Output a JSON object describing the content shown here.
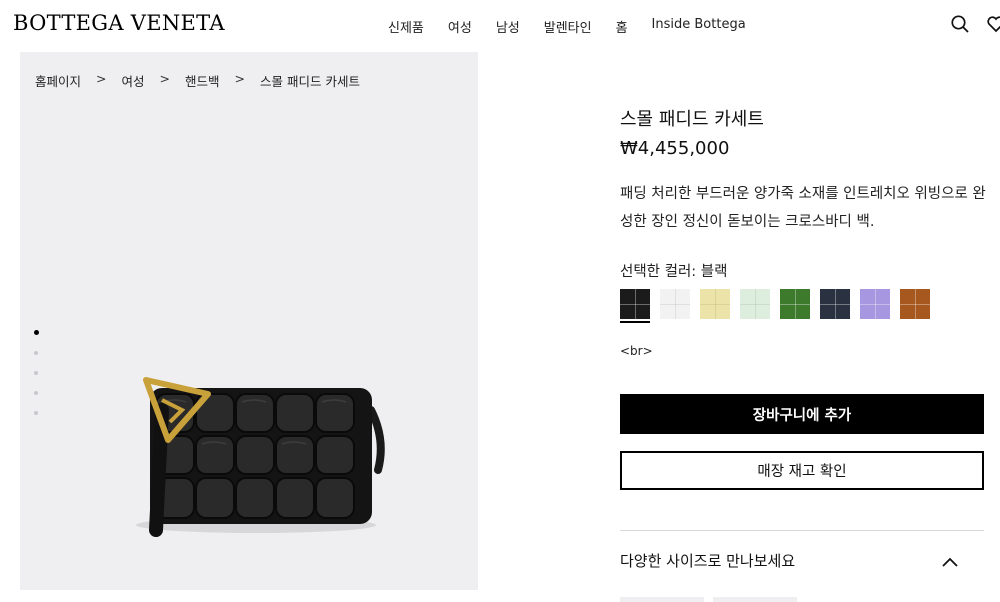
{
  "brand": {
    "logo": "BOTTEGA VENETA"
  },
  "nav": {
    "items": [
      "신제품",
      "여성",
      "남성",
      "발렌타인",
      "홈",
      "Inside Bottega"
    ]
  },
  "header_icons": [
    "search-icon",
    "wishlist-icon"
  ],
  "breadcrumb": {
    "items": [
      "홈페이지",
      "여성",
      "핸드백",
      "스몰 패디드 카세트"
    ],
    "separator": ">"
  },
  "gallery": {
    "image_count": 5,
    "active_index": 0,
    "product_image": "black-padded-cassette-crossbody-bag"
  },
  "product": {
    "title": "스몰 패디드 카세트",
    "price": "₩4,455,000",
    "description": "패딩 처리한 부드러운 양가죽 소재를 인트레치오 위빙으로 완성한 장인 정신이 돋보이는 크로스바디 백.",
    "color_label": "선택한 컬러: 블랙",
    "swatches": [
      {
        "color": "#1b1b1b",
        "selected": true
      },
      {
        "color": "#f2f2f2",
        "selected": false
      },
      {
        "color": "#ece3a8",
        "selected": false
      },
      {
        "color": "#deeede",
        "selected": false
      },
      {
        "color": "#3d7a2c",
        "selected": false
      },
      {
        "color": "#2a3140",
        "selected": false
      },
      {
        "color": "#a796e0",
        "selected": false
      },
      {
        "color": "#a6581f",
        "selected": false
      }
    ],
    "extra_text": "<br>"
  },
  "actions": {
    "add_to_cart": "장바구니에 추가",
    "check_store": "매장 재고 확인"
  },
  "accordion": {
    "label": "다양한 사이즈로 만나보세요",
    "expanded": true
  },
  "colors": {
    "accent": "#000000",
    "gallery_bg": "#efeff1",
    "divider": "#d9d9d9"
  }
}
